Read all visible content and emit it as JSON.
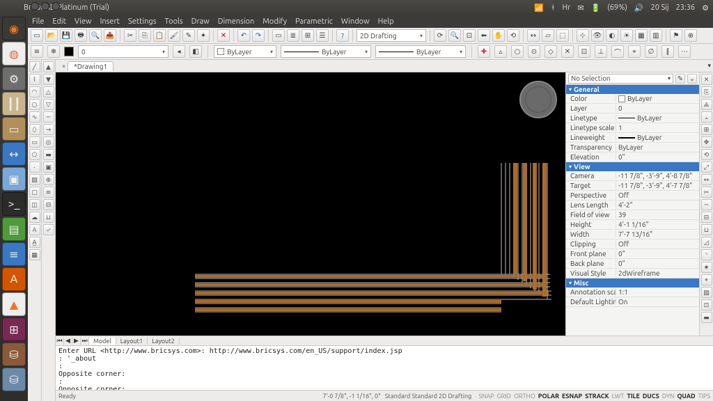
{
  "sysbar": {
    "title": "BricsCAD Platinum (Trial)",
    "lang": "Hr",
    "battery": "(69%)",
    "date": "20 Sij",
    "time": "23:36"
  },
  "menus": [
    "File",
    "Edit",
    "View",
    "Insert",
    "Settings",
    "Tools",
    "Draw",
    "Dimension",
    "Modify",
    "Parametric",
    "Window",
    "Help"
  ],
  "workspace": "2D Drafting",
  "layer_combo": "0",
  "color_combo": "ByLayer",
  "ltype_combo": "ByLayer",
  "lweight_combo": "ByLayer",
  "doc_tab": "*Drawing1",
  "bottom_tabs": [
    "Model",
    "Layout1",
    "Layout2"
  ],
  "cmd_lines": [
    "Enter URL <http://www.bricsys.com>: http://www.bricsys.com/en_US/support/index.jsp",
    ": '_about",
    ":",
    "Opposite corner:",
    ":",
    "Opposite corner:"
  ],
  "status": {
    "ready": "Ready",
    "coords": "7'-0 7/8\", -1 1/16\", 0\"",
    "std": "Standard Standard 2D Drafting",
    "toggles": [
      "SNAP",
      "GRID",
      "ORTHO",
      "POLAR",
      "ESNAP",
      "STRACK",
      "LWT",
      "TILE",
      "DUCS",
      "DYN",
      "QUAD",
      "TIPS"
    ],
    "toggles_on": [
      "POLAR",
      "ESNAP",
      "STRACK",
      "TILE",
      "DUCS",
      "QUAD"
    ]
  },
  "props": {
    "selection": "No Selection",
    "groups": [
      {
        "name": "General",
        "rows": [
          {
            "k": "Color",
            "v": "ByLayer",
            "swatch": true
          },
          {
            "k": "Layer",
            "v": "0"
          },
          {
            "k": "Linetype",
            "v": "ByLayer",
            "line": true
          },
          {
            "k": "Linetype scale",
            "v": "1"
          },
          {
            "k": "Lineweight",
            "v": "ByLayer",
            "lw": true
          },
          {
            "k": "Transparency",
            "v": "ByLayer"
          },
          {
            "k": "Elevation",
            "v": "0\""
          }
        ]
      },
      {
        "name": "View",
        "rows": [
          {
            "k": "Camera",
            "v": "-11 7/8\", -3'-9\", 4'-8 7/8\""
          },
          {
            "k": "Target",
            "v": "-11 7/8\", -3'-9\", 4'-7 7/8\""
          },
          {
            "k": "Perspective",
            "v": "Off"
          },
          {
            "k": "Lens Length",
            "v": "4'-2\""
          },
          {
            "k": "Field of view",
            "v": "39"
          },
          {
            "k": "Height",
            "v": "4'-1 1/16\""
          },
          {
            "k": "Width",
            "v": "7'-7 13/16\""
          },
          {
            "k": "Clipping",
            "v": "Off"
          },
          {
            "k": "Front plane",
            "v": "0\""
          },
          {
            "k": "Back plane",
            "v": "0\""
          },
          {
            "k": "Visual Style",
            "v": "2dWireframe"
          }
        ]
      },
      {
        "name": "Misc",
        "rows": [
          {
            "k": "Annotation scale",
            "v": "1:1"
          },
          {
            "k": "Default Lighting",
            "v": "On"
          }
        ]
      }
    ]
  },
  "launcher_items": [
    "dash",
    "chrome",
    "settings",
    "tuner",
    "files",
    "teamviewer",
    "shot",
    "term",
    "calc",
    "writer",
    "sw",
    "vlc",
    "trash",
    "disk",
    "disk2"
  ]
}
